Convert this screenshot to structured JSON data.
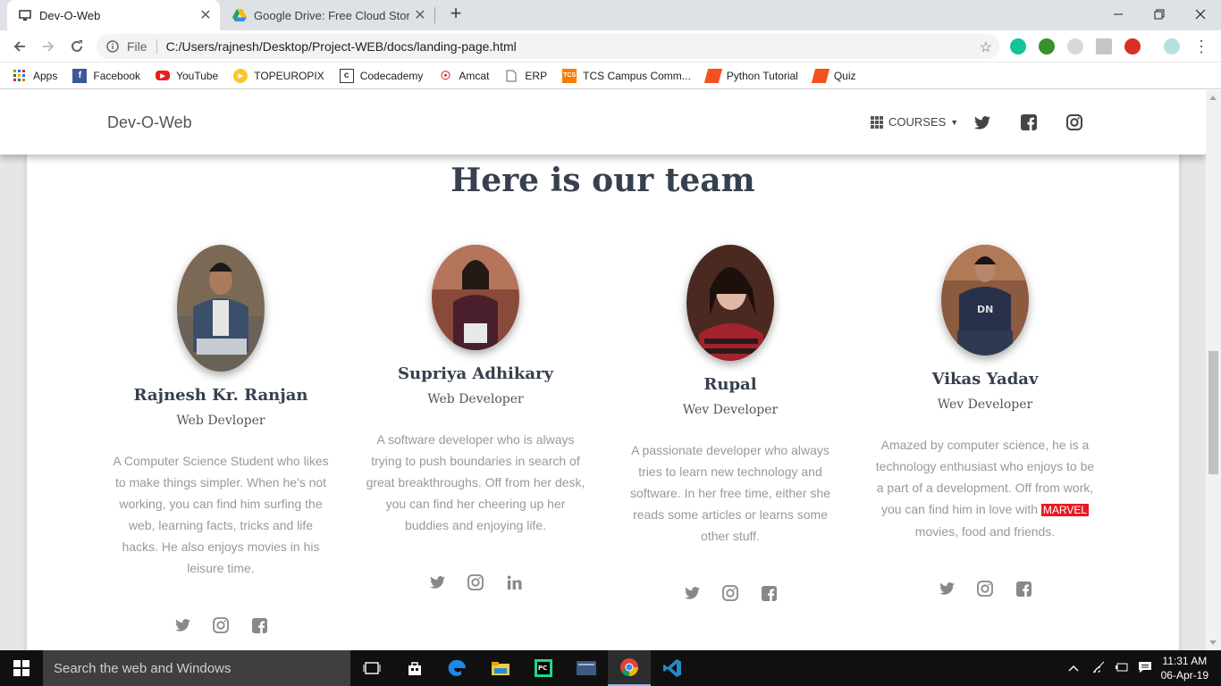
{
  "browser": {
    "tabs": [
      {
        "title": "Dev-O-Web",
        "active": true
      },
      {
        "title": "Google Drive: Free Cloud Storage",
        "active": false
      }
    ],
    "new_tab_label": "+",
    "address": {
      "scheme_label": "File",
      "url": "C:/Users/rajnesh/Desktop/Project-WEB/docs/landing-page.html"
    },
    "bookmarks": [
      {
        "label": "Apps",
        "icon": "apps-grid-icon"
      },
      {
        "label": "Facebook",
        "icon": "facebook-icon"
      },
      {
        "label": "YouTube",
        "icon": "youtube-icon"
      },
      {
        "label": "TOPEUROPIX",
        "icon": "topeuropix-icon"
      },
      {
        "label": "Codecademy",
        "icon": "codecademy-icon"
      },
      {
        "label": "Amcat",
        "icon": "amcat-icon"
      },
      {
        "label": "ERP",
        "icon": "page-icon"
      },
      {
        "label": "TCS Campus Comm...",
        "icon": "tcs-icon"
      },
      {
        "label": "Python Tutorial",
        "icon": "python-tutorial-icon"
      },
      {
        "label": "Quiz",
        "icon": "quiz-icon"
      }
    ]
  },
  "site": {
    "brand": "Dev-O-Web",
    "courses_label": "COURSES",
    "team_heading": "Here is our team",
    "members": [
      {
        "name": "Rajnesh Kr. Ranjan",
        "role": "Web Devloper",
        "bio": "A Computer Science Student who likes to make things simpler. When he's not working, you can find him surfing the web, learning facts, tricks and life hacks. He also enjoys movies in his leisure time.",
        "socials": [
          "twitter-icon",
          "instagram-icon",
          "facebook-icon"
        ]
      },
      {
        "name": "Supriya Adhikary",
        "role": "Web Developer",
        "bio": "A software developer who is always trying to push boundaries in search of great breakthroughs. Off from her desk, you can find her cheering up her buddies and enjoying life.",
        "socials": [
          "twitter-icon",
          "instagram-icon",
          "linkedin-icon"
        ]
      },
      {
        "name": "Rupal",
        "role": "Wev Developer",
        "bio": "A passionate developer who always tries to learn new technology and software. In her free time, either she reads some articles or learns some other stuff.",
        "socials": [
          "twitter-icon",
          "instagram-icon",
          "facebook-icon"
        ]
      },
      {
        "name": "Vikas Yadav",
        "role": "Wev Developer",
        "bio_before": "Amazed by computer science, he is a technology enthusiast who enjoys to be a part of a development. Off from work, you can find him in love with",
        "bio_badge": "MARVEL",
        "bio_after": "movies, food and friends.",
        "socials": [
          "twitter-icon",
          "instagram-icon",
          "facebook-icon"
        ]
      }
    ]
  },
  "taskbar": {
    "search_placeholder": "Search the web and Windows",
    "time": "11:31 AM",
    "date": "06-Apr-19"
  },
  "colors": {
    "heading": "#37404e",
    "body_text": "#999999",
    "marvel_red": "#e61a23",
    "taskbar": "#101010"
  }
}
